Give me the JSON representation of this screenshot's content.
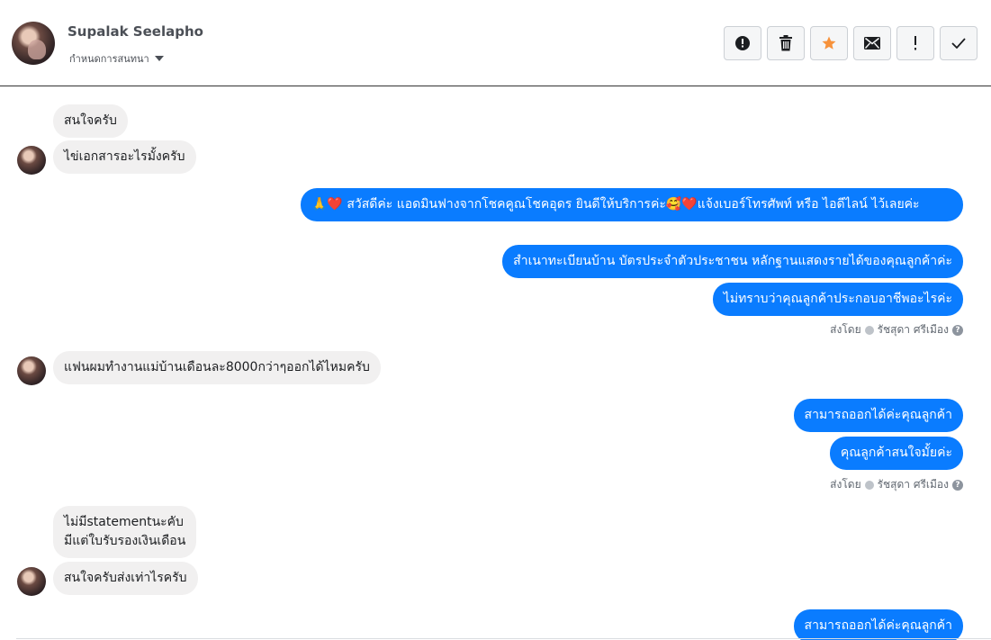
{
  "header": {
    "contact_name": "Supalak Seelapho",
    "assign_label": "กำหนดการสนทนา",
    "toolbar": [
      {
        "icon": "alert-circle-icon",
        "label": "!"
      },
      {
        "icon": "trash-icon"
      },
      {
        "icon": "star-icon",
        "color": "#f7923b"
      },
      {
        "icon": "envelope-icon"
      },
      {
        "icon": "exclamation-icon",
        "label": "!"
      },
      {
        "icon": "checkmark-icon"
      }
    ]
  },
  "messages": {
    "m1": "สนใจครับ",
    "m2": "ไข่เอกสารอะไรมั้งครับ",
    "m3": "🙏❤️ สวัสดีค่ะ แอดมินฟางจากโชคคูณโชคอุดร ยินดีให้บริการค่ะ🥰❤️แจ้งเบอร์โทรศัพท์ หรือ ไอดีไลน์  ไว้เลยค่ะ",
    "m4": "สำเนาทะเบียนบ้าน บัตรประจำตัวประชาชน หลักฐานแสดงรายได้ของคุณลูกค้าค่ะ",
    "m5": "ไม่ทราบว่าคุณลูกค้าประกอบอาชีพอะไรค่ะ",
    "m6": "แฟนผมทำงานแม่บ้านเดือนละ8000กว่าๆออกได้ไหมครับ",
    "m7": "สามารถออกได้ค่ะคุณลูกค้า",
    "m8": "คุณลูกค้าสนใจมั้ยค่ะ",
    "m9_line1": "ไม่มีstatementนะคับ",
    "m9_line2": "มีแต่ใบรับรองเงินเดือน",
    "m10": "สนใจครับส่งเท่าไรครับ",
    "m11": "สามารถออกได้ค่ะคุณลูกค้า"
  },
  "sent_by": {
    "prefix": "ส่งโดย",
    "agent": "รัชสุดา ศรีเมือง",
    "help": "?"
  },
  "colors": {
    "outgoing": "#0a7cff",
    "incoming": "#f1f0f0"
  }
}
